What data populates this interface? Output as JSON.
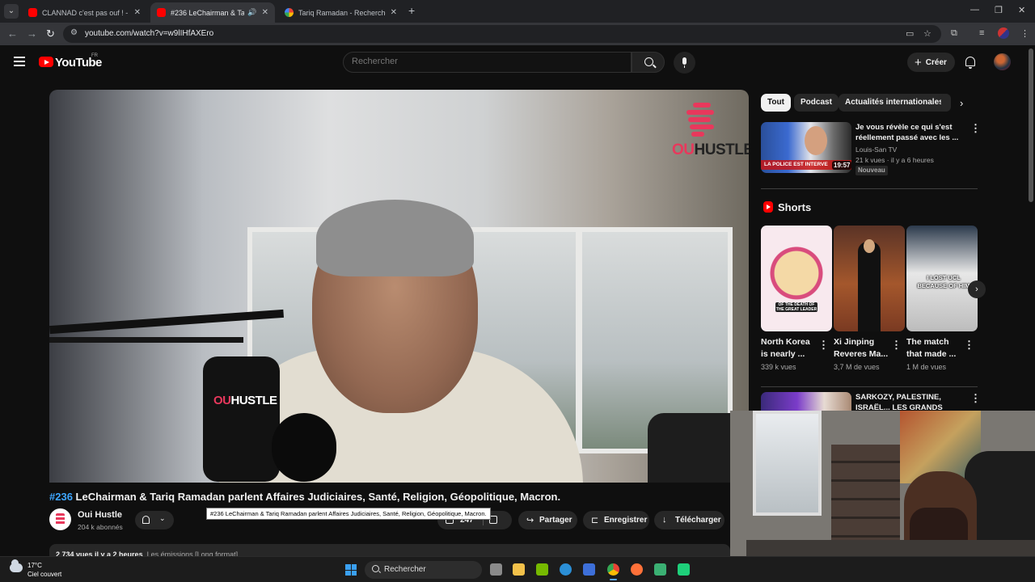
{
  "browser": {
    "tabs": [
      {
        "title": "CLANNAD c'est pas ouf ! - YouT"
      },
      {
        "title": "#236 LeChairman & Tariq R"
      },
      {
        "title": "Tariq Ramadan - Recherche Go"
      }
    ],
    "url": "youtube.com/watch?v=w9lIHfAXEro"
  },
  "youtube": {
    "logo_text": "YouTube",
    "region": "FR",
    "search_placeholder": "Rechercher",
    "create_label": "Créer"
  },
  "player": {
    "brand_text_1": "OU",
    "brand_text_2": "HUSTLE",
    "mic_label_1": "OU",
    "mic_label_2": "HUSTLE"
  },
  "video": {
    "title_tag": "#236",
    "title": " LeChairman & Tariq Ramadan parlent Affaires Judiciaires, Santé, Religion, Géopolitique, Macron.",
    "tooltip": "#236 LeChairman & Tariq Ramadan parlent Affaires Judiciaires, Santé, Religion, Géopolitique, Macron.",
    "channel_name": "Oui Hustle",
    "channel_subs": "204 k abonnés",
    "likes": "247",
    "share_label": "Partager",
    "save_label": "Enregistrer",
    "download_label": "Télécharger",
    "views_date": "2 734 vues  il y a 2 heures",
    "tags": "Les émissions [Long format]"
  },
  "sidebar": {
    "chips": [
      "Tout",
      "Podcast",
      "Actualités internationales"
    ],
    "rec1": {
      "title": "Je vous révèle ce qui s'est réellement passé avec les ...",
      "channel": "Louis-San TV",
      "meta": "21 k vues · il y a 6 heures",
      "badge": "Nouveau",
      "duration": "19:57",
      "thumb_caption": "LA POLICE EST INTERVE"
    },
    "shorts_heading": "Shorts",
    "shorts": [
      {
        "title": "North Korea is nearly ...",
        "views": "339 k vues",
        "caption": "OF THE DEATH OF THE GREAT LEADER"
      },
      {
        "title": "Xi Jinping Reveres Ma...",
        "views": "3,7 M de vues"
      },
      {
        "title": "The match that made ...",
        "views": "1 M de vues",
        "caption": "I LOST UCL BECAUSE OF HIM"
      }
    ],
    "rec2": {
      "title": "SARKOZY, PALESTINE, ISRAËL... LES GRANDS MÉDIA..."
    }
  },
  "taskbar": {
    "temp": "17°C",
    "weather": "Ciel couvert",
    "search_label": "Rechercher"
  }
}
